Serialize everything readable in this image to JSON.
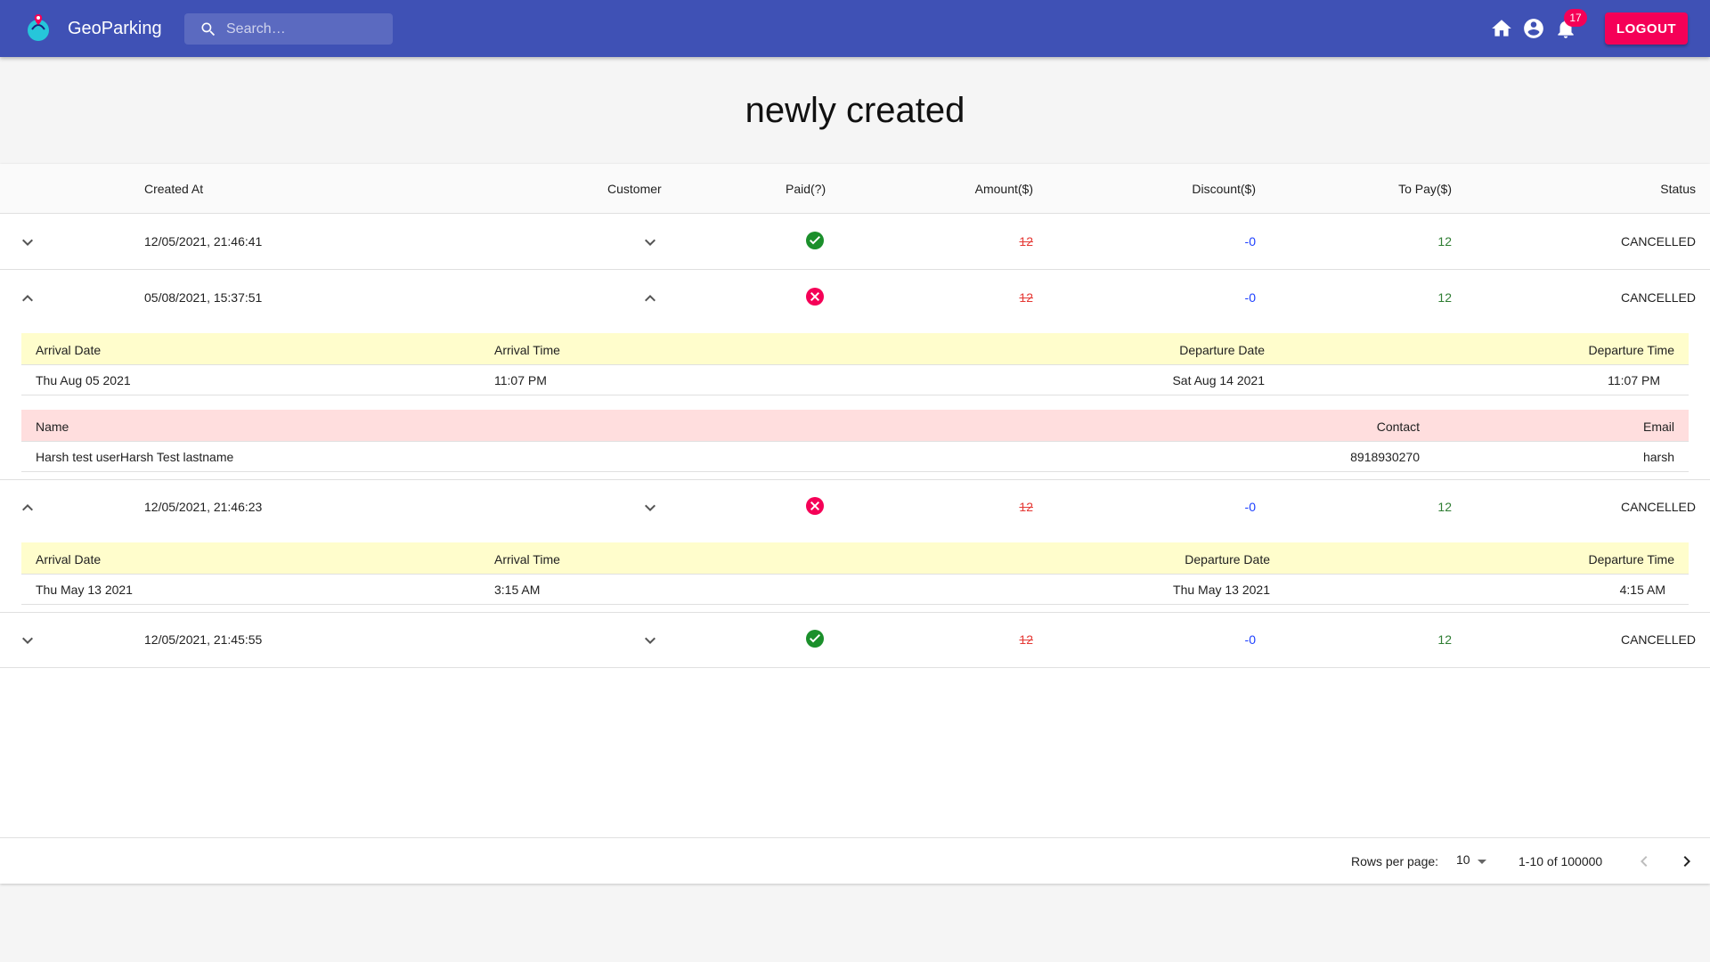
{
  "app": {
    "title": "GeoParking",
    "logo_icon": "parking-pin-logo-icon",
    "search_placeholder": "Search…",
    "notifications_count": "17",
    "logout_label": "LOGOUT",
    "colors": {
      "appbar": "#3f51b5",
      "accent": "#f50057"
    }
  },
  "page": {
    "title": "newly created"
  },
  "table": {
    "columns": [
      "Created At",
      "Customer",
      "Paid(?)",
      "Amount($)",
      "Discount($)",
      "To Pay($)",
      "Status"
    ],
    "rows": [
      {
        "created_at": "12/05/2021, 21:46:41",
        "paid": true,
        "amount": "12",
        "discount": "-0",
        "to_pay": "12",
        "status": "CANCELLED"
      },
      {
        "created_at": "05/08/2021, 15:37:51",
        "paid": false,
        "amount": "12",
        "discount": "-0",
        "to_pay": "12",
        "status": "CANCELLED",
        "booking": {
          "headers": [
            "Arrival Date",
            "Arrival Time",
            "Departure Date",
            "Departure Time"
          ],
          "values": [
            "Thu Aug 05 2021",
            "11:07 PM",
            "Sat Aug 14 2021",
            "11:07 PM"
          ]
        },
        "customer": {
          "headers": [
            "Name",
            "Contact",
            "Email"
          ],
          "values": [
            "Harsh test userHarsh Test lastname",
            "8918930270",
            "harsh"
          ]
        }
      },
      {
        "created_at": "12/05/2021, 21:46:23",
        "paid": false,
        "amount": "12",
        "discount": "-0",
        "to_pay": "12",
        "status": "CANCELLED",
        "booking": {
          "headers": [
            "Arrival Date",
            "Arrival Time",
            "Departure Date",
            "Departure Time"
          ],
          "values": [
            "Thu May 13 2021",
            "3:15 AM",
            "Thu May 13 2021",
            "4:15 AM"
          ]
        }
      },
      {
        "created_at": "12/05/2021, 21:45:55",
        "paid": true,
        "amount": "12",
        "discount": "-0",
        "to_pay": "12",
        "status": "CANCELLED"
      }
    ]
  },
  "pagination": {
    "rows_per_page_label": "Rows per page:",
    "rows_per_page_value": "10",
    "range_label": "1-10 of 100000"
  }
}
